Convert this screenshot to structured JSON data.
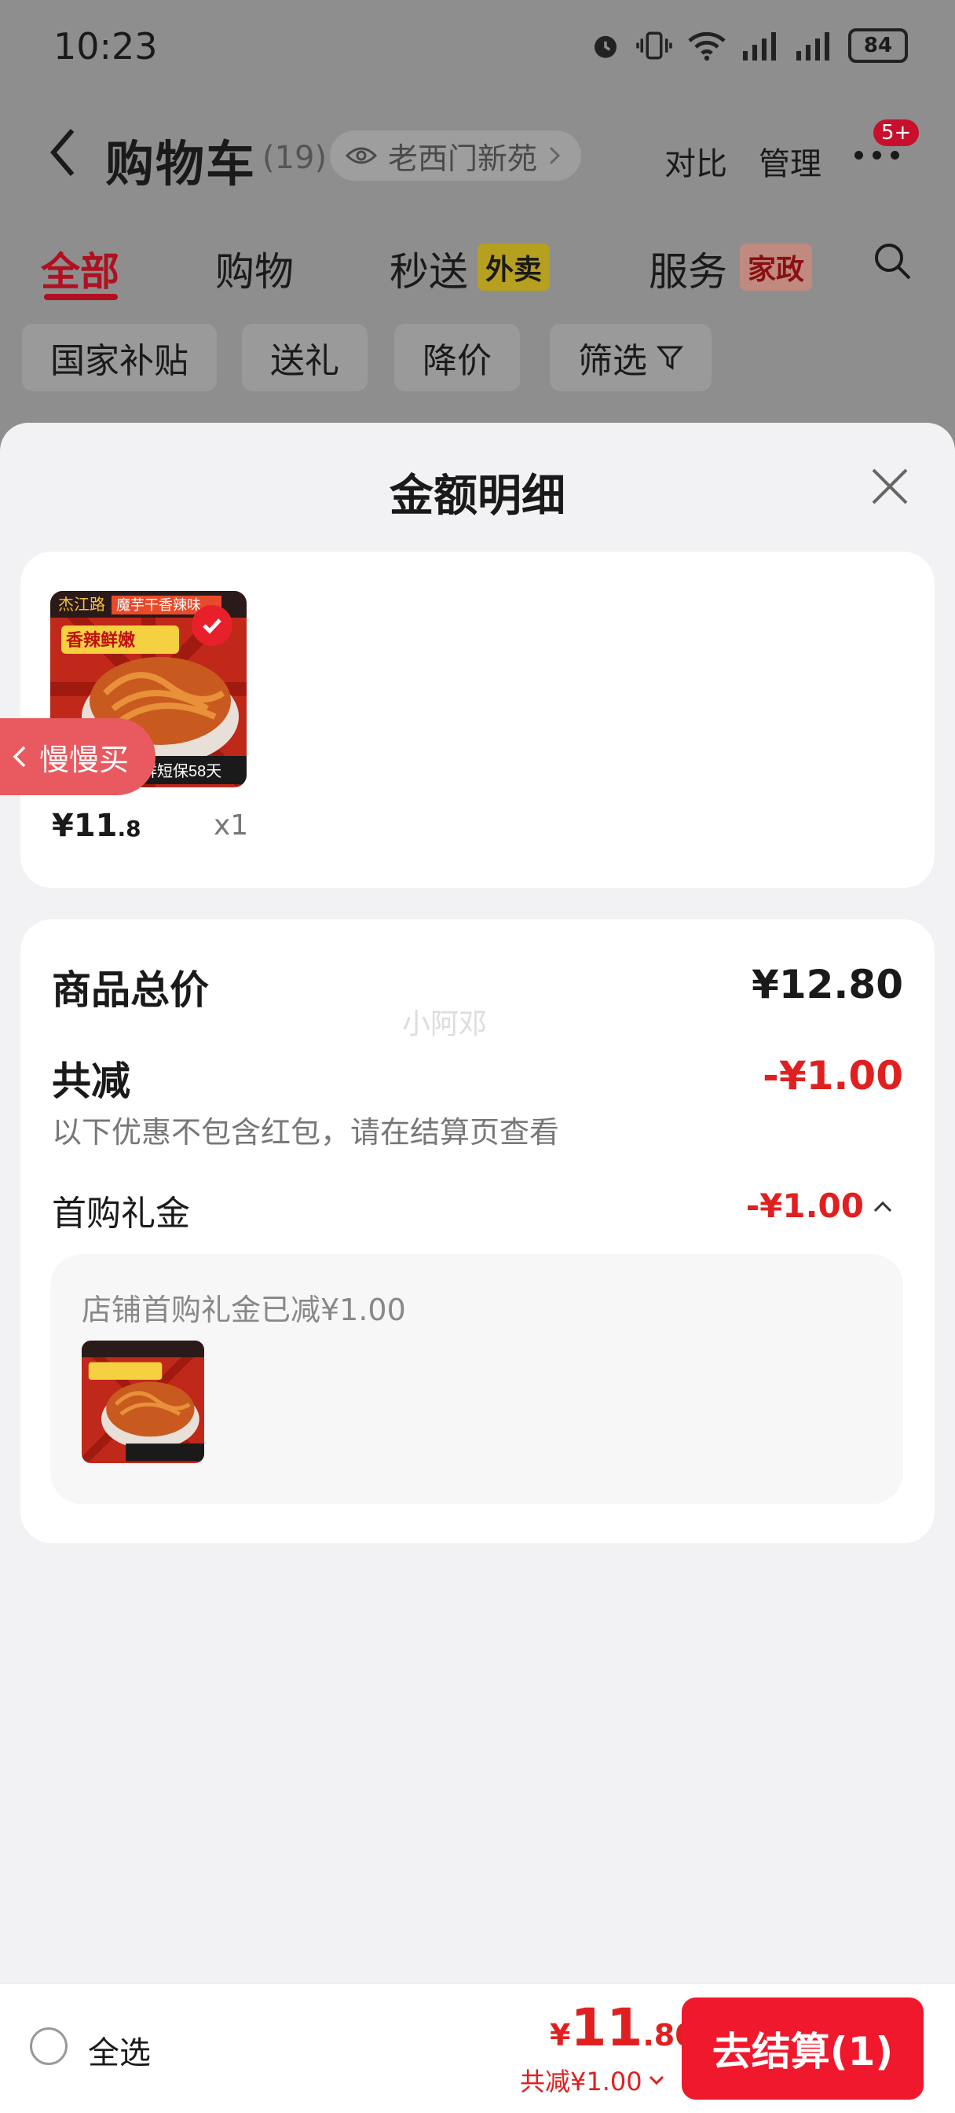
{
  "status_bar": {
    "time": "10:23",
    "battery": "84"
  },
  "header": {
    "title": "购物车",
    "count": "(19)",
    "location": "老西门新苑",
    "compare": "对比",
    "manage": "管理",
    "badge": "5+"
  },
  "tabs": [
    {
      "label": "全部"
    },
    {
      "label": "购物"
    },
    {
      "label": "秒送",
      "tag": "外卖"
    },
    {
      "label": "服务",
      "tag": "家政"
    }
  ],
  "filters": [
    "国家补贴",
    "送礼",
    "降价",
    "筛选"
  ],
  "sheet": {
    "title": "金额明细",
    "item": {
      "price_int": "¥11",
      "price_dec": ".8",
      "qty": "x1",
      "img_brand": "杰江路",
      "img_caption": "魔芋干香辣味",
      "img_tag": "香辣鲜嫩",
      "img_bottom": "新鲜短保58天"
    },
    "slow_buy": "慢慢买",
    "total_label": "商品总价",
    "total_value": "¥12.80",
    "discount_label": "共减",
    "discount_value": "-¥1.00",
    "discount_note": "以下优惠不包含红包，请在结算页查看",
    "gift_label": "首购礼金",
    "gift_value": "-¥1.00",
    "gift_detail": "店铺首购礼金已减¥1.00",
    "watermark": "小阿邓"
  },
  "bottom_bar": {
    "select_all": "全选",
    "price_currency": "¥",
    "price_int": "11",
    "price_dec": ".80",
    "saved": "共减¥1.00",
    "checkout": "去结算(1)"
  }
}
